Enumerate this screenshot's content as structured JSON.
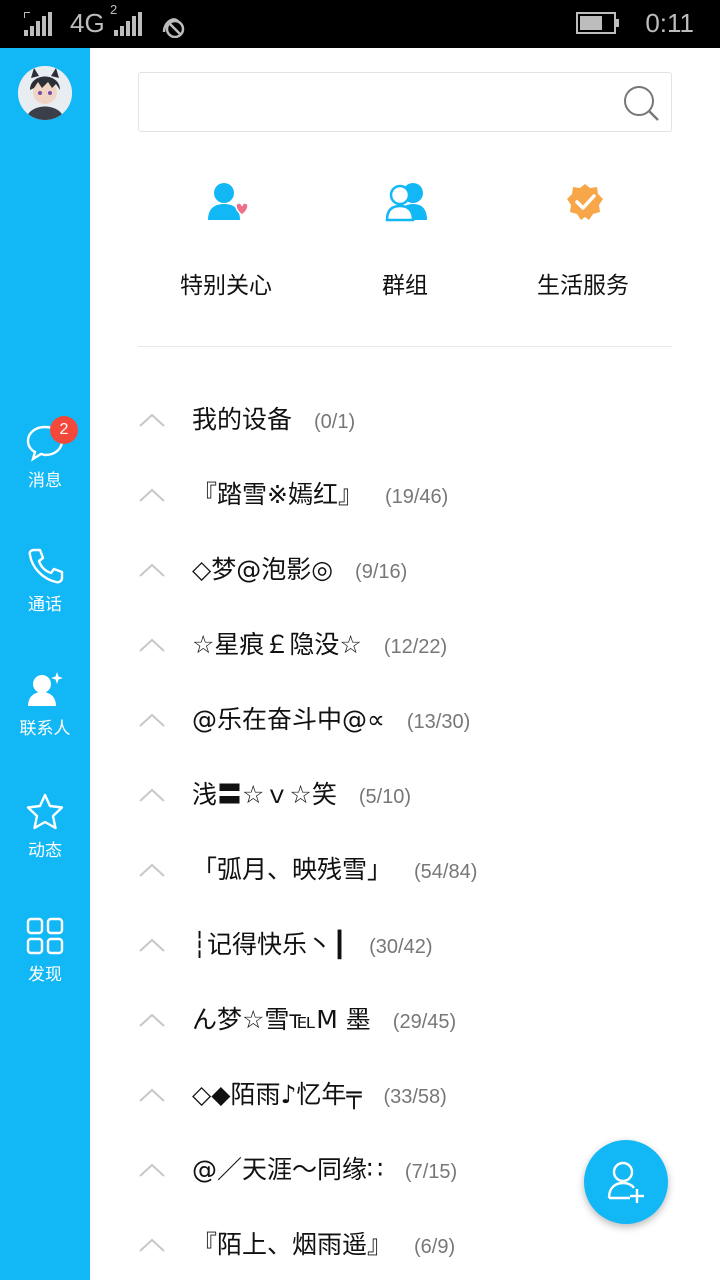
{
  "status_bar": {
    "network": "4G",
    "sim2": "2",
    "time": "0:11"
  },
  "sidebar": {
    "items": [
      {
        "label": "消息",
        "icon": "chat-bubble-icon",
        "badge": "2"
      },
      {
        "label": "通话",
        "icon": "phone-icon"
      },
      {
        "label": "联系人",
        "icon": "contacts-icon"
      },
      {
        "label": "动态",
        "icon": "star-icon"
      },
      {
        "label": "发现",
        "icon": "grid-icon"
      }
    ]
  },
  "search": {
    "placeholder": ""
  },
  "quick_actions": [
    {
      "label": "特别关心",
      "icon": "special-care-icon"
    },
    {
      "label": "群组",
      "icon": "group-icon"
    },
    {
      "label": "生活服务",
      "icon": "life-service-badge-icon"
    }
  ],
  "groups": [
    {
      "name": "我的设备",
      "count": "(0/1)"
    },
    {
      "name": "『踏雪※嫣红』",
      "count": "(19/46)"
    },
    {
      "name": "◇梦@泡影◎",
      "count": "(9/16)"
    },
    {
      "name": "☆星痕￡隐没☆",
      "count": "(12/22)"
    },
    {
      "name": "@乐在奋斗中@∝",
      "count": "(13/30)"
    },
    {
      "name": "浅〓☆ｖ☆笑",
      "count": "(5/10)"
    },
    {
      "name": "「弧月、映残雪」",
      "count": "(54/84)"
    },
    {
      "name": "┆记得快乐丶┃",
      "count": "(30/42)"
    },
    {
      "name": "ん梦☆雪℡M 墨",
      "count": "(29/45)"
    },
    {
      "name": "◇◆陌雨♪忆年╤",
      "count": "(33/58)"
    },
    {
      "name": "@／天涯～同缘∷",
      "count": "(7/15)"
    },
    {
      "name": "『陌上、烟雨遥』",
      "count": "(6/9)"
    }
  ],
  "colors": {
    "accent": "#12b7f5",
    "badge": "#f4493a",
    "service_orange": "#f7a649"
  }
}
